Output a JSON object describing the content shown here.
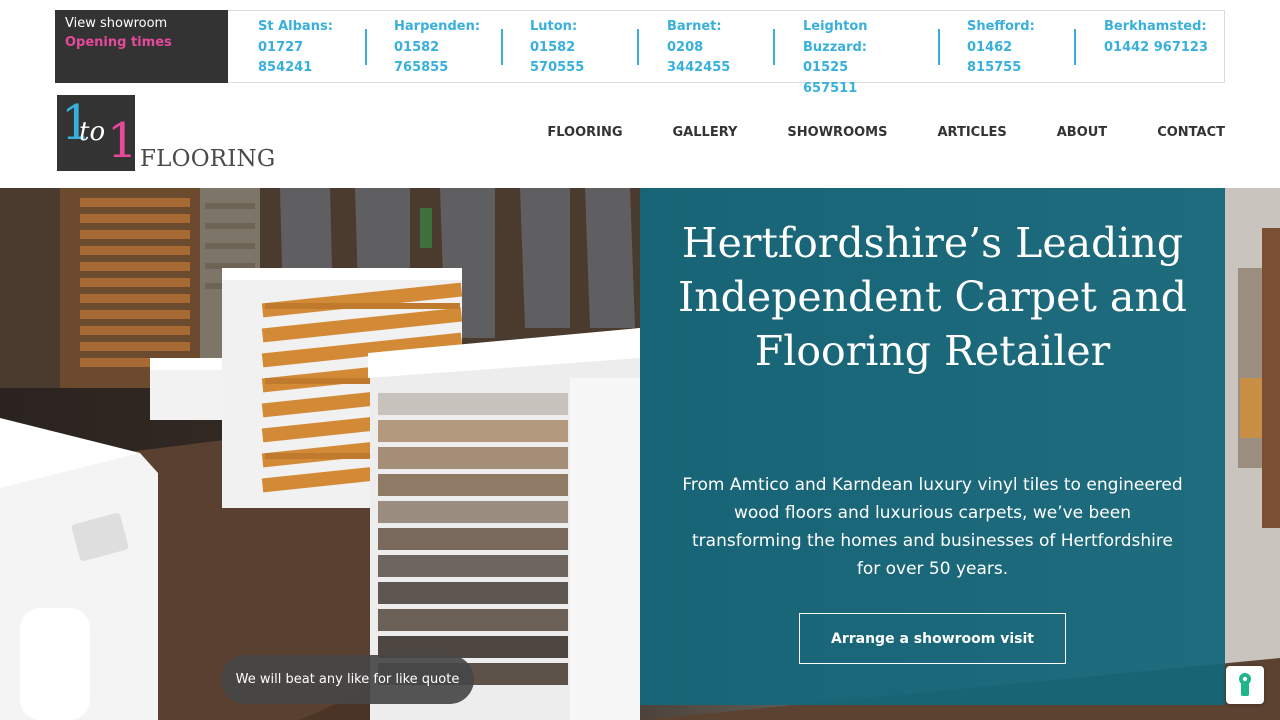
{
  "topbar": {
    "view_showroom": "View showroom",
    "opening_times": "Opening times",
    "phones": [
      {
        "label": "St Albans:",
        "number": "01727 854241"
      },
      {
        "label": "Harpenden:",
        "number": "01582 765855"
      },
      {
        "label": "Luton:",
        "number": "01582 570555"
      },
      {
        "label": "Barnet:",
        "number": "0208 3442455"
      },
      {
        "label": "Leighton Buzzard:",
        "number": "01525 657511"
      },
      {
        "label": "Shefford:",
        "number": "01462 815755"
      },
      {
        "label": "Berkhamsted:",
        "number": "01442 967123"
      }
    ]
  },
  "logo": {
    "mark_one": "1",
    "mark_to": "to",
    "mark_one_b": "1",
    "wordmark": "FLOORING"
  },
  "nav": {
    "items": [
      "FLOORING",
      "GALLERY",
      "SHOWROOMS",
      "ARTICLES",
      "ABOUT",
      "CONTACT"
    ]
  },
  "hero": {
    "heading": "Hertfordshire’s Leading Independent Carpet and Flooring Retailer",
    "description": "From Amtico and Karndean luxury vinyl tiles to engineered wood floors and luxurious carpets, we’ve been transforming the homes and businesses of Hertfordshire for over 50 years.",
    "cta_label": "Arrange a showroom visit",
    "quote_pill": "We will beat any like for like quote"
  },
  "colors": {
    "accent_blue": "#39b0dc",
    "accent_pink": "#e6499a",
    "panel_teal": "#13677b",
    "dark": "#333333"
  },
  "icons": {
    "accessibility": "accessibility-keyhole-icon"
  }
}
